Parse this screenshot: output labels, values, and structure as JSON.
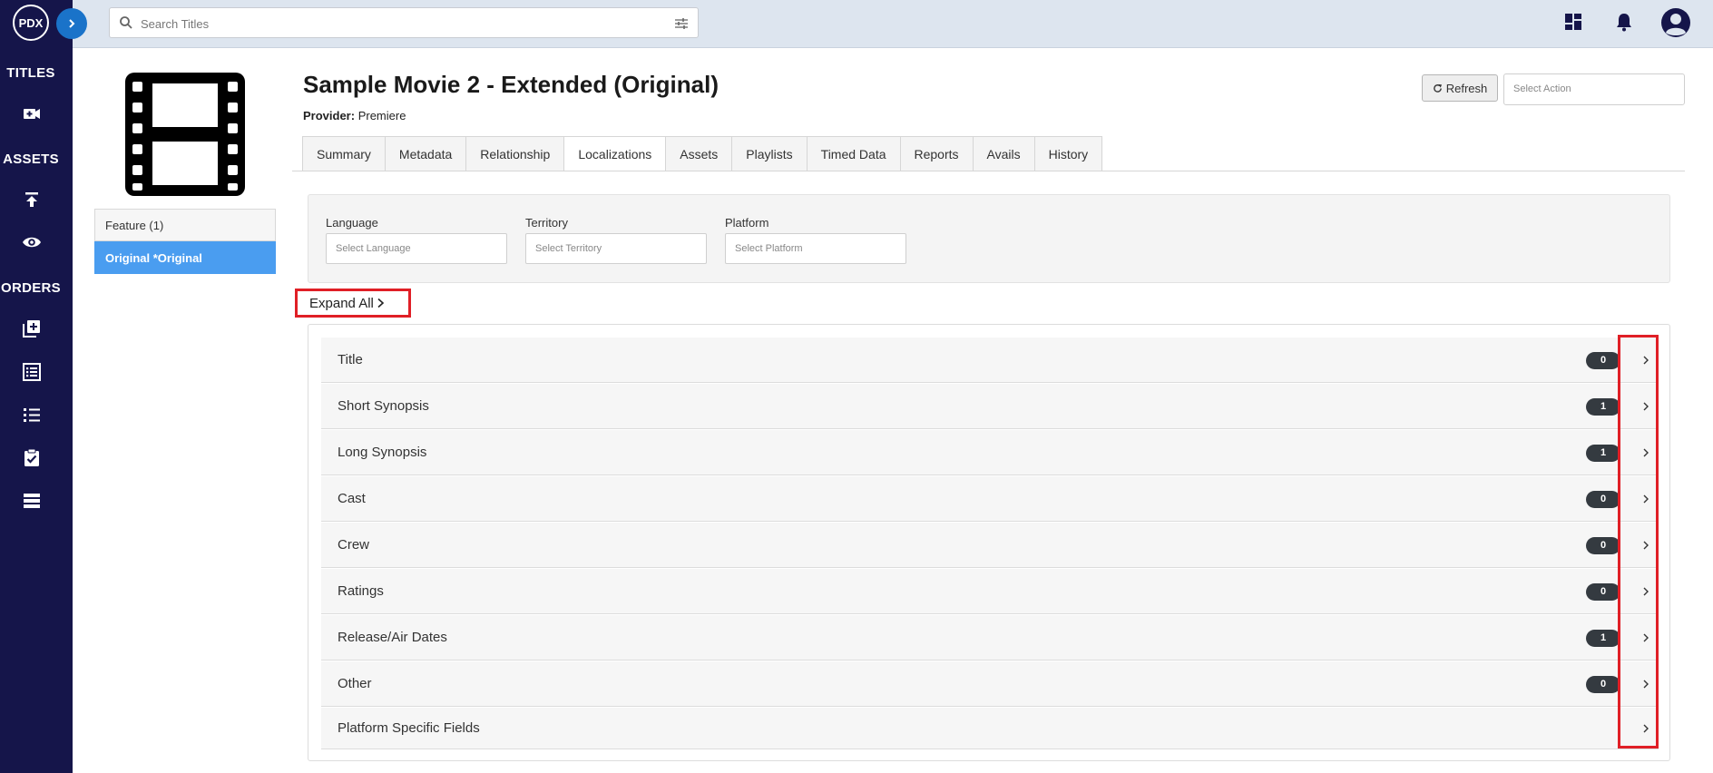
{
  "app": {
    "logo_text": "PDX"
  },
  "topbar": {
    "search_placeholder": "Search Titles"
  },
  "sidebar": {
    "sections": [
      {
        "label": "TITLES"
      },
      {
        "label": "ASSETS"
      },
      {
        "label": "ORDERS"
      }
    ]
  },
  "tree": {
    "items": [
      {
        "label": "Feature (1)"
      },
      {
        "label": "Original *Original"
      }
    ]
  },
  "header": {
    "title": "Sample Movie 2 - Extended (Original)",
    "provider_label": "Provider:",
    "provider_value": "Premiere",
    "refresh_label": "Refresh",
    "action_placeholder": "Select Action"
  },
  "tabs": [
    {
      "label": "Summary"
    },
    {
      "label": "Metadata"
    },
    {
      "label": "Relationship"
    },
    {
      "label": "Localizations"
    },
    {
      "label": "Assets"
    },
    {
      "label": "Playlists"
    },
    {
      "label": "Timed Data"
    },
    {
      "label": "Reports"
    },
    {
      "label": "Avails"
    },
    {
      "label": "History"
    }
  ],
  "filters": {
    "language": {
      "label": "Language",
      "placeholder": "Select Language"
    },
    "territory": {
      "label": "Territory",
      "placeholder": "Select Territory"
    },
    "platform": {
      "label": "Platform",
      "placeholder": "Select Platform"
    }
  },
  "expand_all_label": "Expand All",
  "sections": [
    {
      "label": "Title",
      "count": "0"
    },
    {
      "label": "Short Synopsis",
      "count": "1"
    },
    {
      "label": "Long Synopsis",
      "count": "1"
    },
    {
      "label": "Cast",
      "count": "0"
    },
    {
      "label": "Crew",
      "count": "0"
    },
    {
      "label": "Ratings",
      "count": "0"
    },
    {
      "label": "Release/Air Dates",
      "count": "1"
    },
    {
      "label": "Other",
      "count": "0"
    },
    {
      "label": "Platform Specific Fields"
    }
  ],
  "colors": {
    "sidebar_bg": "#15154a",
    "topbar_bg": "#dde5ef",
    "selected_item": "#4a9df0",
    "badge_bg": "#343a40",
    "highlight": "#e01f26"
  }
}
